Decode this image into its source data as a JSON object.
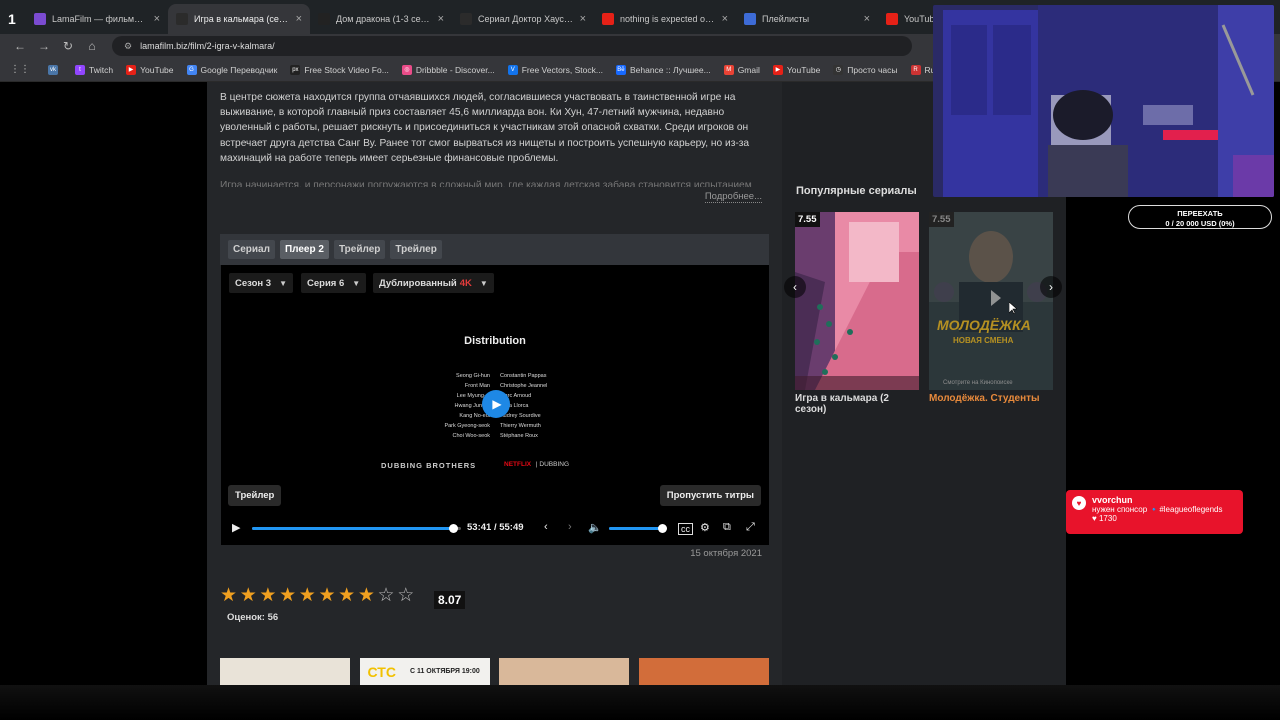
{
  "browser": {
    "tabs": [
      {
        "title": "LamaFilm — фильмы и се",
        "fav_color": "#7b4bd1",
        "active": false
      },
      {
        "title": "Игра в кальмара (сериал",
        "fav_color": "#2b2b2b",
        "active": true
      },
      {
        "title": "Дом дракона (1-3 сезон)",
        "fav_color": "#222",
        "active": false
      },
      {
        "title": "Сериал Доктор Хаус (200",
        "fav_color": "#2b2b2b",
        "active": false
      },
      {
        "title": "nothing is expected of you",
        "fav_color": "#e62117",
        "active": false
      },
      {
        "title": "Плейлисты",
        "fav_color": "#3d6bd6",
        "active": false
      },
      {
        "title": "YouTube",
        "fav_color": "#e62117",
        "active": false
      }
    ],
    "tab_counter": "1",
    "address": "lamafilm.biz/film/2-igra-v-kalmara/",
    "bookmarks": [
      {
        "label": "",
        "color": "#4a76a8",
        "glyph": "vk"
      },
      {
        "label": "Twitch",
        "color": "#9146ff",
        "glyph": "t"
      },
      {
        "label": "YouTube",
        "color": "#e62117",
        "glyph": "▶"
      },
      {
        "label": "Google Переводчик",
        "color": "#4285f4",
        "glyph": "G"
      },
      {
        "label": "Free Stock Video Fo...",
        "color": "#222",
        "glyph": "px"
      },
      {
        "label": "Dribbble - Discover...",
        "color": "#ea4c89",
        "glyph": "◎"
      },
      {
        "label": "Free Vectors, Stock...",
        "color": "#1273eb",
        "glyph": "V"
      },
      {
        "label": "Behance :: Лучшее...",
        "color": "#1769ff",
        "glyph": "Bē"
      },
      {
        "label": "Gmail",
        "color": "#ea4335",
        "glyph": "M"
      },
      {
        "label": "YouTube",
        "color": "#e62117",
        "glyph": "▶"
      },
      {
        "label": "Просто часы",
        "color": "#333",
        "glyph": "◷"
      },
      {
        "label": "RuTracker.org",
        "color": "#c33",
        "glyph": "R"
      }
    ]
  },
  "description": {
    "paragraph1": "В центре сюжета находится группа отчаявшихся людей, согласившиеся участвовать в таинственной игре на выживание, в которой главный приз составляет 45,6 миллиарда вон. Ки Хун, 47-летний мужчина, недавно уволенный с работы, решает рискнуть и присоединиться к участникам этой опасной схватки. Среди игроков он встречает друга детства Санг Ву. Ранее тот смог вырваться из нищеты и построить успешную карьеру, но из-за махинаций на работе теперь имеет серьезные финансовые проблемы.",
    "paragraph2": "Игра начинается, и персонажи погружаются в сложный мир, где каждая детская забава становится испытанием",
    "more_link": "Подробнее..."
  },
  "player": {
    "tabs": [
      "Сериал",
      "Плеер 2",
      "Трейлер",
      "Трейлер"
    ],
    "active_tab": 1,
    "season": "Сезон 3",
    "episode": "Серия 6",
    "voice": "Дублированный",
    "quality": "4K",
    "credits_title": "Distribution",
    "credits_left": [
      "Seong Gi-hun",
      "Front Man",
      "Lee Myung-gi",
      "Hwang Jun-ho",
      "Kang No-eul",
      "Park Gyeong-seok",
      "Choi Woo-seok"
    ],
    "credits_right": [
      "Constantin Pappas",
      "Christophe Jeannel",
      "Marc Arnoud",
      "Elisa Llorca",
      "Audrey Sourdive",
      "Thierry Wermuth",
      "Stéphane Roux"
    ],
    "dubbing_studio": "DUBBING BROTHERS",
    "netflix": "NETFLIX",
    "netflix_suffix": "| DUBBING",
    "trailer_btn": "Трейлер",
    "skip_btn": "Пропустить титры",
    "time_current": "53:41",
    "time_total": "55:49",
    "progress": 0.962,
    "volume": 0.95,
    "date": "15 октября 2021",
    "accent": "#2196f3"
  },
  "rating": {
    "value": "8.07",
    "stars_filled": 8,
    "stars_half": 0,
    "stars_total": 10,
    "votes": "Оценок: 56"
  },
  "sidebar": {
    "title": "Популярные сериалы",
    "cards": [
      {
        "rating": "7.55",
        "title": "Игра в кальмара (2 сезон)",
        "highlight": false
      },
      {
        "rating": "7.55",
        "title": "Молодёжка. Студенты",
        "highlight": true
      }
    ],
    "card2_poster_text": "МОЛОДЁЖКА",
    "card2_poster_sub": "НОВАЯ СМЕНА",
    "card2_caption": "Смотрите на Кинопоиске"
  },
  "overlays": {
    "donate_line1": "ПЕРЕЕХАТЬ",
    "donate_line2": "0 / 20 000 USD (0%)",
    "sponsor_user": "vvorchun",
    "sponsor_msg": "нужен спонсор 🔹#leagueoflegends",
    "sponsor_count": "1730"
  },
  "thumbs": [
    {
      "color": "#e9e3d8"
    },
    {
      "color": "#f2f1ee",
      "text": "СТС",
      "sub": "С 11 ОКТЯБРЯ 19:00"
    },
    {
      "color": "#d9b89a"
    },
    {
      "color": "#d26d3a"
    }
  ]
}
